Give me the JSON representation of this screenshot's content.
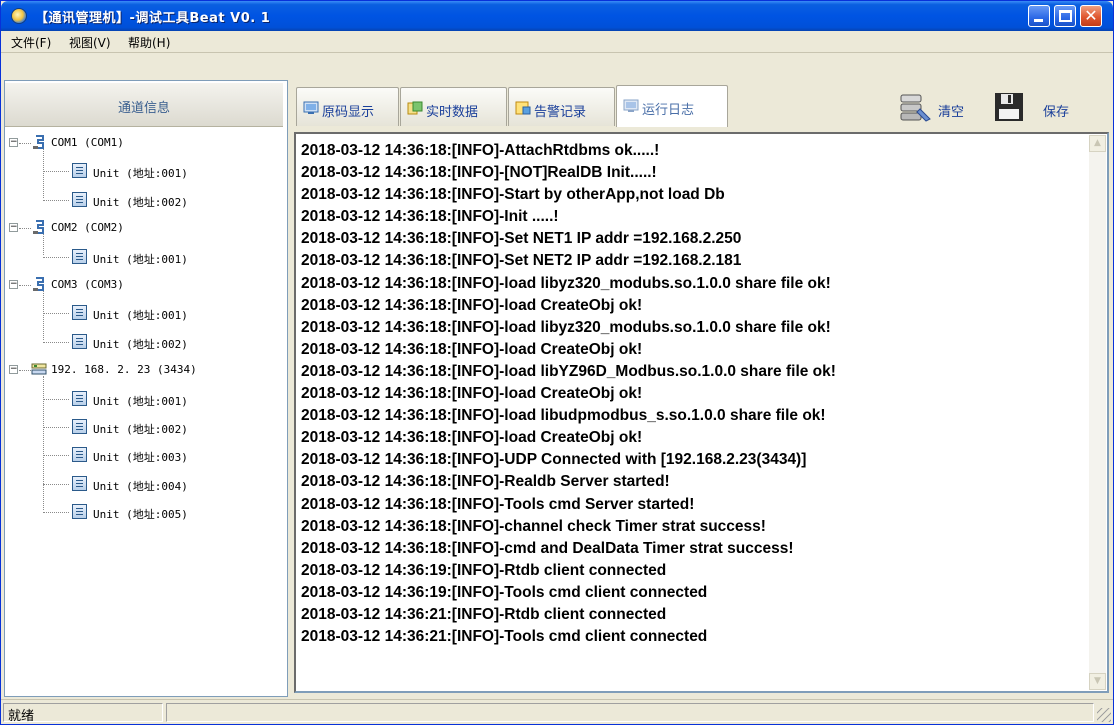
{
  "window": {
    "title": "【通讯管理机】-调试工具Beat V0. 1"
  },
  "menu": [
    {
      "label": "文件(F)"
    },
    {
      "label": "视图(V)"
    },
    {
      "label": "帮助(H)"
    }
  ],
  "channel_panel": {
    "header": "通道信息",
    "tree": [
      {
        "label": "COM1 (COM1)",
        "type": "serial-port",
        "units": [
          "Unit (地址:001)",
          "Unit (地址:002)"
        ]
      },
      {
        "label": "COM2 (COM2)",
        "type": "serial-port",
        "units": [
          "Unit (地址:001)"
        ]
      },
      {
        "label": "COM3 (COM3)",
        "type": "serial-port",
        "units": [
          "Unit (地址:001)",
          "Unit (地址:002)"
        ]
      },
      {
        "label": "192. 168. 2. 23 (3434)",
        "type": "network",
        "units": [
          "Unit (地址:001)",
          "Unit (地址:002)",
          "Unit (地址:003)",
          "Unit (地址:004)",
          "Unit (地址:005)"
        ]
      }
    ]
  },
  "tabs": [
    {
      "label": "原码显示",
      "active": false
    },
    {
      "label": "实时数据",
      "active": false
    },
    {
      "label": "告警记录",
      "active": false
    },
    {
      "label": "运行日志",
      "active": true
    }
  ],
  "toolbar": {
    "clear_label": "清空",
    "save_label": "保存"
  },
  "log": [
    "2018-03-12 14:36:18:[INFO]-AttachRtdbms ok.....!",
    "2018-03-12 14:36:18:[INFO]-[NOT]RealDB Init.....!",
    "2018-03-12 14:36:18:[INFO]-Start by otherApp,not load Db",
    "2018-03-12 14:36:18:[INFO]-Init .....!",
    "2018-03-12 14:36:18:[INFO]-Set NET1 IP addr =192.168.2.250",
    "2018-03-12 14:36:18:[INFO]-Set NET2 IP addr =192.168.2.181",
    "2018-03-12 14:36:18:[INFO]-load libyz320_modubs.so.1.0.0 share file ok!",
    "2018-03-12 14:36:18:[INFO]-load CreateObj ok!",
    "2018-03-12 14:36:18:[INFO]-load libyz320_modubs.so.1.0.0 share file ok!",
    "2018-03-12 14:36:18:[INFO]-load CreateObj ok!",
    "2018-03-12 14:36:18:[INFO]-load libYZ96D_Modbus.so.1.0.0 share file ok!",
    "2018-03-12 14:36:18:[INFO]-load CreateObj ok!",
    "2018-03-12 14:36:18:[INFO]-load libudpmodbus_s.so.1.0.0 share file ok!",
    "2018-03-12 14:36:18:[INFO]-load CreateObj ok!",
    "2018-03-12 14:36:18:[INFO]-UDP Connected with [192.168.2.23(3434)]",
    "2018-03-12 14:36:18:[INFO]-Realdb Server started!",
    "2018-03-12 14:36:18:[INFO]-Tools cmd Server started!",
    "2018-03-12 14:36:18:[INFO]-channel check Timer strat success!",
    "2018-03-12 14:36:18:[INFO]-cmd and DealData Timer strat success!",
    "2018-03-12 14:36:19:[INFO]-Rtdb client connected",
    "2018-03-12 14:36:19:[INFO]-Tools cmd client connected",
    "2018-03-12 14:36:21:[INFO]-Rtdb client connected",
    "2018-03-12 14:36:21:[INFO]-Tools cmd client connected"
  ],
  "status": {
    "text": "就绪"
  }
}
